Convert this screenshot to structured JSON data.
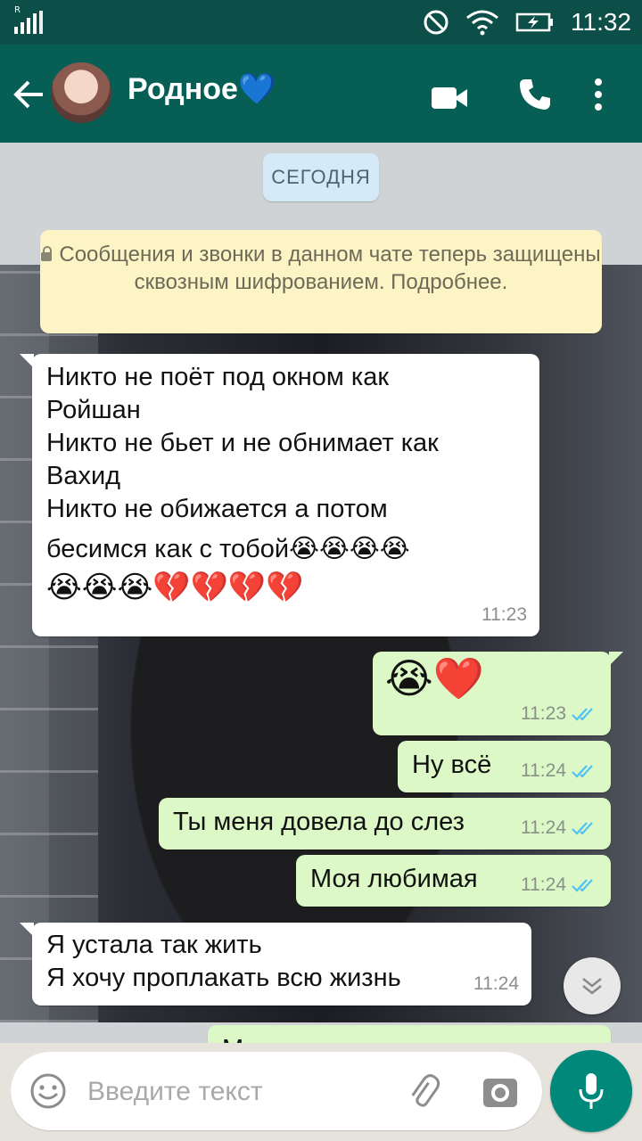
{
  "status_bar": {
    "time": "11:32",
    "carrier_badge": "R"
  },
  "header": {
    "contact_name": "Родное💙"
  },
  "chat": {
    "date_label": "СЕГОДНЯ",
    "encryption_notice": "Сообщения и звонки в данном чате теперь защищены сквозным шифрованием. Подробнее.",
    "messages": [
      {
        "direction": "incoming",
        "lines": [
          "Никто не поёт под окном как",
          "Ройшан",
          "Никто не бьет и не обнимает как",
          "Вахид",
          "Никто не обижается а потом",
          "бесимся как с тобой😭😭😭😭",
          "😭😭😭💔💔💔💔"
        ],
        "time": "11:23"
      },
      {
        "direction": "outgoing",
        "text": "😭❤️",
        "time": "11:23",
        "status": "read"
      },
      {
        "direction": "outgoing",
        "text": "Ну всё",
        "time": "11:24",
        "status": "read"
      },
      {
        "direction": "outgoing",
        "text": "Ты меня довела до слез",
        "time": "11:24",
        "status": "read"
      },
      {
        "direction": "outgoing",
        "text": "Моя любимая",
        "time": "11:24",
        "status": "read"
      },
      {
        "direction": "incoming",
        "lines": [
          "Я устала так жить",
          "Я хочу проплакать всю жизнь"
        ],
        "time": "11:24"
      },
      {
        "direction": "outgoing",
        "text": "Моя родная девочка",
        "partial": true
      }
    ]
  },
  "input": {
    "placeholder": "Введите текст"
  },
  "icons": [
    "back-arrow-icon",
    "video-call-icon",
    "phone-icon",
    "more-vert-icon",
    "emoji-icon",
    "attach-icon",
    "camera-icon",
    "mic-icon",
    "scroll-down-icon",
    "read-checks-icon",
    "lock-icon",
    "dnd-icon",
    "wifi-icon",
    "battery-charging-icon",
    "signal-icon"
  ],
  "colors": {
    "header": "#075e54",
    "status_bar": "#0b4f48",
    "outgoing_bubble": "#dcf8c6",
    "incoming_bubble": "#ffffff",
    "read_ticks": "#4fc3f7",
    "fab": "#00897b"
  }
}
